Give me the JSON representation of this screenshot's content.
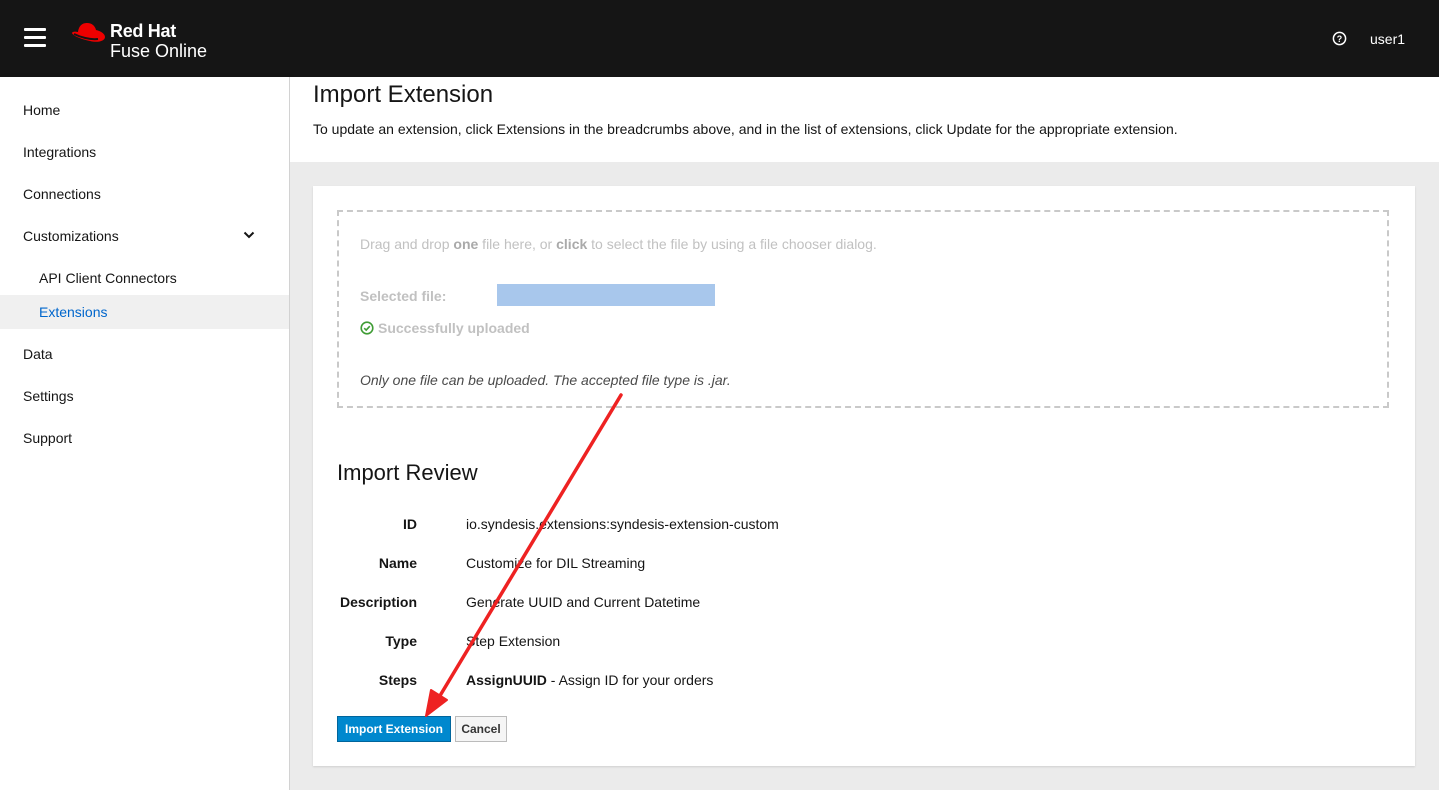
{
  "app": {
    "brand_line1": "Red Hat",
    "brand_line2": "Fuse Online",
    "user": "user1",
    "icons": {
      "menu": "hamburger-icon",
      "help": "help-circle-icon",
      "logo": "red-hat-fedora-logo"
    }
  },
  "sidebar": {
    "items": [
      {
        "label": "Home"
      },
      {
        "label": "Integrations"
      },
      {
        "label": "Connections"
      },
      {
        "label": "Customizations",
        "expanded": true
      },
      {
        "label": "API Client Connectors",
        "sub": true
      },
      {
        "label": "Extensions",
        "sub": true,
        "active": true
      },
      {
        "label": "Data"
      },
      {
        "label": "Settings"
      },
      {
        "label": "Support"
      }
    ]
  },
  "page": {
    "title": "Import Extension",
    "description": "To update an extension, click Extensions in the breadcrumbs above, and in the list of extensions, click Update for the appropriate extension."
  },
  "dropzone": {
    "instr_part1": "Drag and drop ",
    "instr_bold1": "one",
    "instr_part2": " file here, or ",
    "instr_bold2": "click",
    "instr_part3": " to select the file by using a file chooser dialog.",
    "selected_label": "Selected file:",
    "selected_file": "",
    "success_text": "Successfully uploaded",
    "note": "Only one file can be uploaded. The accepted file type is .jar."
  },
  "review": {
    "title": "Import Review",
    "id_label": "ID",
    "id_value": "io.syndesis.extensions:syndesis-extension-custom",
    "name_label": "Name",
    "name_value": "Customize for DIL Streaming",
    "description_label": "Description",
    "description_value": "Generate UUID and Current Datetime",
    "type_label": "Type",
    "type_value": "Step Extension",
    "steps_label": "Steps",
    "step_name": "AssignUUID",
    "step_desc": " - Assign ID for your orders"
  },
  "buttons": {
    "import": "Import Extension",
    "cancel": "Cancel"
  },
  "colors": {
    "topbar": "#151515",
    "brand_red": "#ee0000",
    "link_blue": "#0066cc",
    "primary_button": "#0088ce",
    "annotation_arrow": "#ee2222",
    "success_green": "#3f9c35"
  }
}
